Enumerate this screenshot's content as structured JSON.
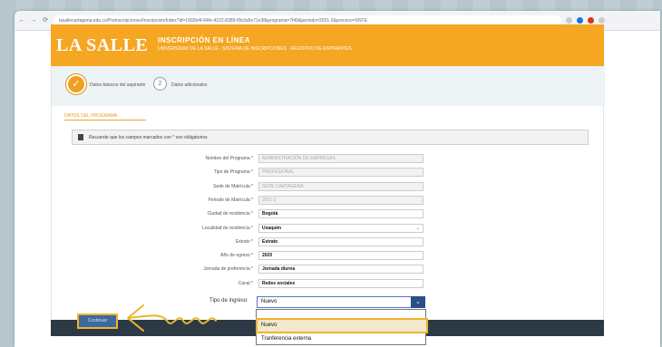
{
  "browser": {
    "nav_back": "←",
    "nav_forward": "→",
    "nav_reload": "⟳",
    "url": "lasallecartagena.edu.co/Preinscripciones/Inscripcion/Index?id=1992b4f-64fe-4222-8389-f0b3a5e71e3f&programa=7f49&periodo=2021-2&proceso=SNTE"
  },
  "header": {
    "brand": "LA SALLE",
    "subtitle": "INSCRIPCIÓN EN LÍNEA",
    "tagline": "UNIVERSIDAD DE LA SALLE - SISTEMA DE INSCRIPCIONES · REGISTRO DE ASPIRANTES"
  },
  "steps": [
    {
      "num": "✓",
      "label": "Datos básicos del aspirante"
    },
    {
      "num": "2",
      "label": "Datos adicionales"
    }
  ],
  "section_title": "DATOS DEL PROGRAMA",
  "alert_text": "Recuerde que los campos marcados con * son obligatorios",
  "form": {
    "fields": [
      {
        "label": "Nombre del Programa *",
        "value": "ADMINISTRACIÓN DE EMPRESAS",
        "state": "dis"
      },
      {
        "label": "Tipo de Programa *",
        "value": "PROFESIONAL",
        "state": "dis"
      },
      {
        "label": "Sede de Matrícula *",
        "value": "SEDE CARTAGENA",
        "state": "dis"
      },
      {
        "label": "Periodo de Matrícula *",
        "value": "2021-2",
        "state": "dis"
      },
      {
        "label": "Ciudad de residencia *",
        "value": "Bogotá",
        "state": "filled"
      },
      {
        "label": "Localidad de residencia *",
        "value": "Usaquén",
        "state": "filled",
        "caret": "⌄"
      },
      {
        "label": "Estrato *",
        "value": "Estrato",
        "state": "filled"
      },
      {
        "label": "Año de egreso *",
        "value": "2020",
        "state": "filled"
      },
      {
        "label": "Jornada de preferencia *",
        "value": "Jornada diurna",
        "state": "filled"
      },
      {
        "label": "Canal *",
        "value": "Redes sociales",
        "state": "filled"
      }
    ],
    "ingreso_label": "Tipo de ingreso:",
    "ingreso_value": "Nuevo",
    "ingreso_caret": "⌄"
  },
  "dropdown_options": [
    "Nuevo",
    "Tranferencia externa"
  ],
  "continue_button": "Continuar",
  "colors": {
    "brand_orange": "#f5a623",
    "highlight": "#f0b429",
    "select_blue": "#2a4f86"
  },
  "icons": {
    "step_done": "check-icon",
    "dropdown": "chevron-down-icon",
    "annotation": "arrow-left-icon"
  }
}
